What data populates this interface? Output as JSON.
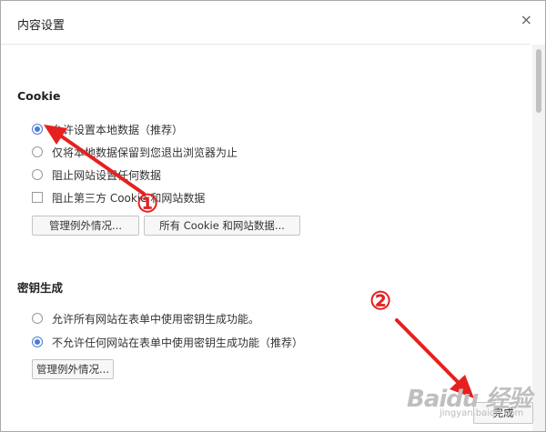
{
  "dialog": {
    "title": "内容设置",
    "close_glyph": "×"
  },
  "cookie": {
    "heading": "Cookie",
    "options": [
      {
        "label": "允许设置本地数据（推荐）",
        "selected": true
      },
      {
        "label": "仅将本地数据保留到您退出浏览器为止",
        "selected": false
      },
      {
        "label": "阻止网站设置任何数据",
        "selected": false
      }
    ],
    "block_third_party": {
      "label": "阻止第三方 Cookie 和网站数据",
      "checked": false
    },
    "manage_exceptions_label": "管理例外情况...",
    "all_cookies_label": "所有 Cookie 和网站数据..."
  },
  "keygen": {
    "heading": "密钥生成",
    "options": [
      {
        "label": "允许所有网站在表单中使用密钥生成功能。",
        "selected": false
      },
      {
        "label": "不允许任何网站在表单中使用密钥生成功能（推荐）",
        "selected": true
      }
    ],
    "manage_exceptions_label": "管理例外情况..."
  },
  "footer": {
    "done_label": "完成"
  },
  "annotations": {
    "marker_1": "①",
    "marker_2": "②",
    "arrow_color": "#e62020"
  },
  "watermark": {
    "text": "Baidu 经验",
    "sub": "jingyan.baidu.com"
  }
}
